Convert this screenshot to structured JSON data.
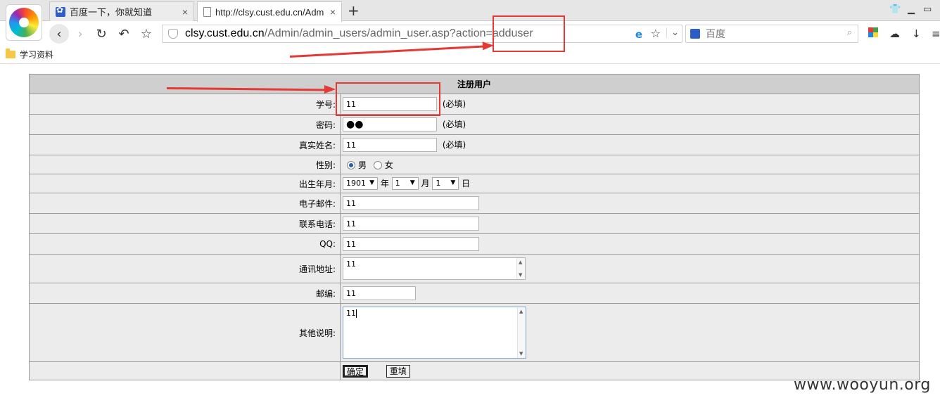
{
  "browser": {
    "tabs": [
      {
        "label": "百度一下，你就知道",
        "close": "×"
      },
      {
        "label": "http://clsy.cust.edu.cn/Adm",
        "close": "×"
      }
    ],
    "new_tab": "+",
    "url_host": "clsy.cust.edu.cn",
    "url_path": "/Admin/admin_users/admin_user.asp?action=adduser",
    "search_placeholder": "百度",
    "bookmark_folder": "学习资料"
  },
  "form": {
    "title": "注册用户",
    "required_note": "(必填)",
    "fields": {
      "student_id": {
        "label": "学号:",
        "value": "11"
      },
      "password": {
        "label": "密码:",
        "value": "●●"
      },
      "real_name": {
        "label": "真实姓名:",
        "value": "11"
      },
      "gender": {
        "label": "性别:",
        "male": "男",
        "female": "女",
        "selected": "男"
      },
      "birth": {
        "label": "出生年月:",
        "year": "1901",
        "year_unit": "年",
        "month": "1",
        "month_unit": "月",
        "day": "1",
        "day_unit": "日"
      },
      "email": {
        "label": "电子邮件:",
        "value": "11"
      },
      "phone": {
        "label": "联系电话:",
        "value": "11"
      },
      "qq": {
        "label": "QQ:",
        "value": "11"
      },
      "address": {
        "label": "通讯地址:",
        "value": "11"
      },
      "postcode": {
        "label": "邮编:",
        "value": "11"
      },
      "other": {
        "label": "其他说明:",
        "value": "11"
      }
    },
    "submit_label": "确定",
    "reset_label": "重填"
  },
  "watermark": "www.wooyun.org",
  "colors": {
    "annotation": "#e53935",
    "header_bg": "#cfcfcf",
    "row_bg": "#ececec"
  }
}
